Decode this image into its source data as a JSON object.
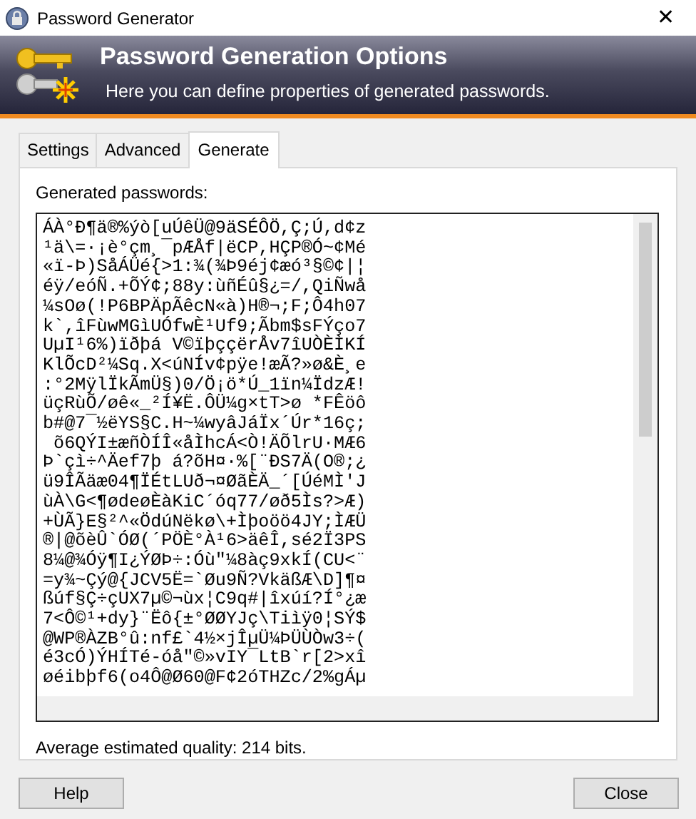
{
  "window": {
    "title": "Password Generator",
    "close": "✕"
  },
  "header": {
    "title": "Password Generation Options",
    "subtitle": "Here you can define properties of generated passwords."
  },
  "tabs": [
    {
      "label": "Settings",
      "selected": false
    },
    {
      "label": "Advanced",
      "selected": false
    },
    {
      "label": "Generate",
      "selected": true
    }
  ],
  "generated_label": "Generated passwords:",
  "passwords": [
    "ÁÀ°Ð¶ä®%ýò[uÚêÜ@9äSÉÔÖ,Ç;Ú,d¢z",
    "¹ä\\=·¡è°çm¸¯pÆÅf|ëCP,HÇP®Ó~¢Mé",
    "«ï-Þ)SåÁÜé{>1:¾(¾Þ9éj¢æó³§©¢|¦",
    "éÿ/eóÑ.+ÕÝ¢;88y:ùñÉû§¿=/,QiÑwå",
    "¼sOø(!P6BPÄpÃêcN«à)H®¬;F;Ô4h07",
    "k`,îFùwMGìUÓfwÈ¹Uf9;Ãbm$sFÝço7",
    "UµI¹6%)ïðþá V©ïþççërÅv7îUÒÈÌKÍ",
    "KlÕcD²¼Sq.X<úNÍv¢pÿe!æÃ?»ø&È¸e",
    ":°2MÿlÏkÃmÜ§)0/Ö¡ö*Ú_1ïn¼ÏdzÆ!",
    "üçRùÕ/øê«_²Í¥Ë.ÔÜ¼g×tT>ø *FÊöô",
    "b#@7¯½ëYS§C.H~¼wyâJáÏx´Úr*16ç;",
    " õ6QÝI±æñÒÍÎ«åÌhcÁ<Ò!ÄÕlrU·MÆ6",
    "Þ`çì÷^Äef7þ á?õH¤·%[¨ÐS7Ä(O®;¿",
    "ü9ÎÃäæ04¶ÏÉtLUð¬¤ØãÈÄ_´[ÚéMÌ'J",
    "ùÀ\\G<¶ødeøÈàKiC´óq77/øð5Ìs?>Æ)",
    "+ÙÃ}E§²^«ÖdúNëkø\\+Ìþoöö4JY;ÌÆÜ",
    "®|@õèÛ`ÓØ(´PÖÈ°À¹6>äêÎ,sé2Ï3PS",
    "8¼@¾Óÿ¶I¿ÝØÞ÷:Óù\"¼8àç9xkÍ(CU<¨",
    "=y¾~Çý@{JCV5Ë=`Øu9Ñ?VkäßÆ\\D]¶¤",
    "ßúf§Ç÷çUX7µ©¬ùx¦C9q#|îxúí?Í°¿æ",
    "7<Ô©¹+dy}¨Ëô{±°ØØYJç\\Tiìÿ0¦SÝ$",
    "@WP®ÀZB°û:nf£`4½×jÎµÜ¼ÞÜÙÒw3÷(",
    "é3cÓ)ÝHÍTé-óå\"©»vIY¯LtB`r[2>xî",
    "øéibþf6(o4Ô@Ø60@F¢2óTHZc/2%gÁµ"
  ],
  "quality": "Average estimated quality: 214 bits.",
  "buttons": [
    "Help",
    "Close"
  ]
}
